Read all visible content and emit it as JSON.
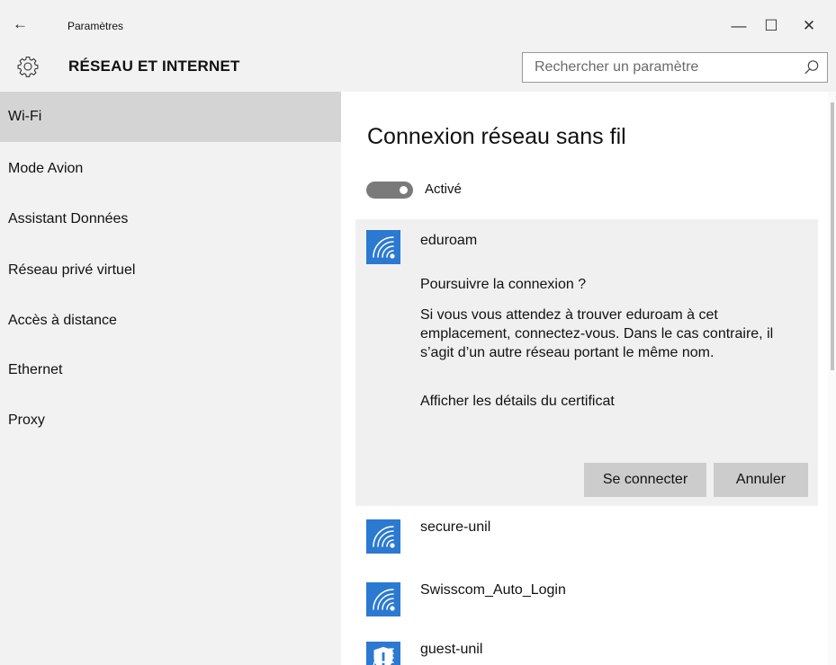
{
  "window": {
    "title": "Paramètres",
    "back_icon": "arrow-left-icon",
    "minimize_glyph": "—",
    "maximize_glyph": "☐",
    "close_glyph": "✕"
  },
  "header": {
    "icon": "gear-icon",
    "title": "RÉSEAU ET INTERNET",
    "search_placeholder": "Rechercher un paramètre"
  },
  "sidebar": {
    "items": [
      {
        "label": "Wi-Fi",
        "selected": true
      },
      {
        "label": "Mode Avion",
        "selected": false
      },
      {
        "label": "Assistant Données",
        "selected": false
      },
      {
        "label": "Réseau privé virtuel",
        "selected": false
      },
      {
        "label": "Accès à distance",
        "selected": false
      },
      {
        "label": "Ethernet",
        "selected": false
      },
      {
        "label": "Proxy",
        "selected": false
      }
    ]
  },
  "main": {
    "title": "Connexion réseau sans fil",
    "toggle": {
      "label": "Activé",
      "on": true
    },
    "expanded_network": {
      "name": "eduroam",
      "prompt": "Poursuivre la connexion ?",
      "body": "Si vous vous attendez à trouver eduroam à cet emplacement, connectez-vous. Dans le cas contraire, il s’agit d’un autre réseau portant le même nom.",
      "cert_link": "Afficher les détails du certificat",
      "connect_label": "Se connecter",
      "cancel_label": "Annuler"
    },
    "networks": [
      {
        "name": "secure-unil",
        "secured": false
      },
      {
        "name": "Swisscom_Auto_Login",
        "secured": false
      },
      {
        "name": "guest-unil",
        "secured": true
      }
    ]
  },
  "colors": {
    "accent": "#2b79d1",
    "sidebar_bg": "#f2f2f2",
    "selected_bg": "#d4d4d4",
    "button_bg": "#cccccc",
    "toggle_on": "#7a7a7a"
  }
}
